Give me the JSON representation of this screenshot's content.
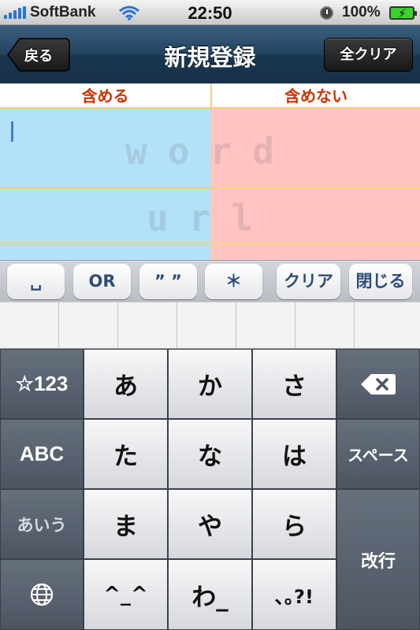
{
  "status_bar": {
    "carrier": "SoftBank",
    "time": "22:50",
    "battery": "100%"
  },
  "nav": {
    "back_label": "戻る",
    "title": "新規登録",
    "clear_all_label": "全クリア"
  },
  "columns": {
    "include": "含める",
    "exclude": "含めない"
  },
  "watermark": {
    "word": "word",
    "url": "url"
  },
  "accessory_keys": {
    "space": "␣",
    "or": "OR",
    "quotes": "” ”",
    "asterisk": "＊",
    "clear": "クリア",
    "close": "閉じる"
  },
  "keyboard": {
    "mode_key": "☆123",
    "abc_key": "ABC",
    "hiragana_key": "あいう",
    "space_key": "スペース",
    "return_key": "改行",
    "kana": [
      "あ",
      "か",
      "さ",
      "た",
      "な",
      "は",
      "ま",
      "や",
      "ら",
      "^_^",
      "わ_",
      "､｡?!"
    ]
  },
  "colors": {
    "include_bg": "#b3e2f8",
    "exclude_bg": "#ffc4c2",
    "header_text": "#cc3300",
    "accessory_text": "#2e4c77"
  }
}
